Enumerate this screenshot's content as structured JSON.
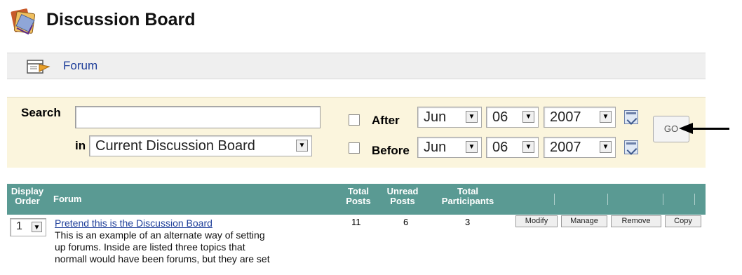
{
  "header": {
    "title": "Discussion Board",
    "icon": "discussion-board-icon"
  },
  "action_bar": {
    "forum_label": "Forum",
    "icon": "forum-add-icon"
  },
  "search": {
    "label": "Search",
    "query": "",
    "in_label": "in",
    "scope_value": "Current Discussion Board",
    "after": {
      "label": "After",
      "checked": false,
      "month": "Jun",
      "day": "06",
      "year": "2007"
    },
    "before": {
      "label": "Before",
      "checked": false,
      "month": "Jun",
      "day": "06",
      "year": "2007"
    },
    "go_label": "GO"
  },
  "table": {
    "headers": {
      "display_order": [
        "Display",
        "Order"
      ],
      "forum": "Forum",
      "total_posts": [
        "Total",
        "Posts"
      ],
      "unread_posts": [
        "Unread",
        "Posts"
      ],
      "total_participants": [
        "Total",
        "Participants"
      ]
    },
    "rows": [
      {
        "order": "1",
        "title": "Pretend this is the Discussion Board",
        "description": [
          "This is an example of an alternate way of setting",
          "up forums. Inside are listed three topics that",
          "normall would have been forums, but they are set"
        ],
        "total_posts": "11",
        "unread_posts": "6",
        "total_participants": "3",
        "actions": [
          "Modify",
          "Manage",
          "Remove",
          "Copy"
        ]
      }
    ]
  },
  "colors": {
    "header_bar": "#5a9a93",
    "search_panel": "#fbf5dd",
    "action_bar": "#efefef",
    "link": "#1f3f9a"
  }
}
